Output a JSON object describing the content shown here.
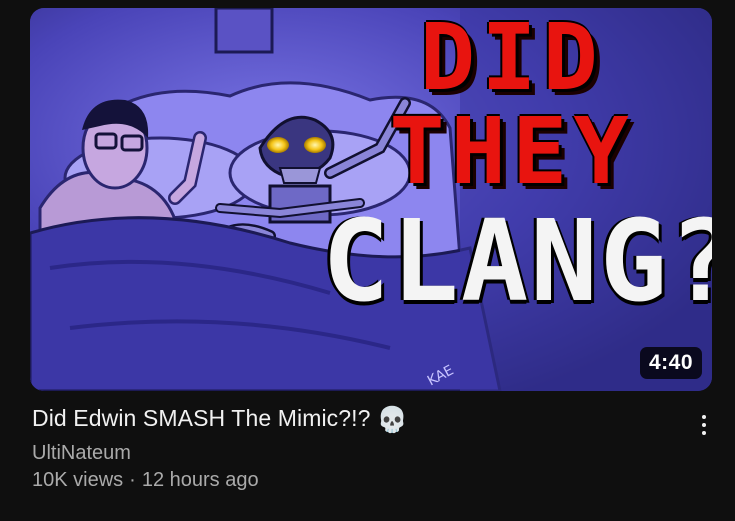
{
  "video": {
    "title": "Did Edwin SMASH The Mimic?!?",
    "title_emoji": "💀",
    "channel": "UltiNateum",
    "views": "10K views",
    "separator": "·",
    "age": "12 hours ago",
    "duration": "4:40"
  },
  "thumbnail": {
    "line1": "DID",
    "line2": "THEY",
    "line3": "CLANG?",
    "signature": "KAE",
    "colors": {
      "background": "#2b2a7a",
      "title_red": "#e8140f",
      "title_white": "#f4f4f4",
      "eyes": "#f5c518"
    }
  },
  "icons": {
    "more": "more-vertical-icon"
  }
}
